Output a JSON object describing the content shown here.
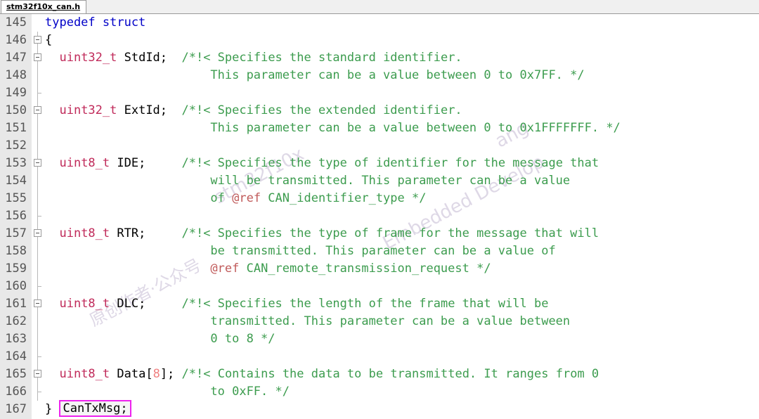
{
  "window": {
    "tab_label": "stm32f10x_can.h"
  },
  "watermark": {
    "line1": "stm32f10x",
    "line2": "Embedded Develop",
    "line3": "ang",
    "line4": "原创作者·公众号"
  },
  "editor": {
    "first_line_number": 145,
    "highlight_color": "#ee22ee",
    "keyword_color": "#0000c8",
    "type_color": "#c02a5a",
    "comment_color": "#3c9c4e",
    "doctag_color": "#c05a5a",
    "number_color": "#f08080",
    "gutter_color": "#e8e8e8",
    "lines": [
      {
        "n": "145",
        "fold": "none",
        "tokens": [
          {
            "t": "kw",
            "s": "typedef struct"
          }
        ]
      },
      {
        "n": "146",
        "fold": "box",
        "tokens": [
          {
            "t": "plain",
            "s": "{"
          }
        ]
      },
      {
        "n": "147",
        "fold": "box",
        "tokens": [
          {
            "t": "plain",
            "s": "  "
          },
          {
            "t": "typ",
            "s": "uint32_t"
          },
          {
            "t": "plain",
            "s": " StdId;  "
          },
          {
            "t": "cmt",
            "s": "/*!< Specifies the standard identifier."
          }
        ]
      },
      {
        "n": "148",
        "fold": "line",
        "tokens": [
          {
            "t": "cmt",
            "s": "                       This parameter can be a value between 0 to 0x7FF. */"
          }
        ]
      },
      {
        "n": "149",
        "fold": "tick",
        "tokens": [
          {
            "t": "plain",
            "s": ""
          }
        ]
      },
      {
        "n": "150",
        "fold": "box",
        "tokens": [
          {
            "t": "plain",
            "s": "  "
          },
          {
            "t": "typ",
            "s": "uint32_t"
          },
          {
            "t": "plain",
            "s": " ExtId;  "
          },
          {
            "t": "cmt",
            "s": "/*!< Specifies the extended identifier."
          }
        ]
      },
      {
        "n": "151",
        "fold": "line",
        "tokens": [
          {
            "t": "cmt",
            "s": "                       This parameter can be a value between 0 to 0x1FFFFFFF. */"
          }
        ]
      },
      {
        "n": "152",
        "fold": "line",
        "tokens": [
          {
            "t": "plain",
            "s": ""
          }
        ]
      },
      {
        "n": "153",
        "fold": "box",
        "tokens": [
          {
            "t": "plain",
            "s": "  "
          },
          {
            "t": "typ",
            "s": "uint8_t"
          },
          {
            "t": "plain",
            "s": " IDE;     "
          },
          {
            "t": "cmt",
            "s": "/*!< Specifies the type of identifier for the message that"
          }
        ]
      },
      {
        "n": "154",
        "fold": "line",
        "tokens": [
          {
            "t": "cmt",
            "s": "                       will be transmitted. This parameter can be a value"
          }
        ]
      },
      {
        "n": "155",
        "fold": "line",
        "tokens": [
          {
            "t": "cmt",
            "s": "                       of "
          },
          {
            "t": "tag",
            "s": "@ref"
          },
          {
            "t": "cmt",
            "s": " CAN_identifier_type */"
          }
        ]
      },
      {
        "n": "156",
        "fold": "tick",
        "tokens": [
          {
            "t": "plain",
            "s": ""
          }
        ]
      },
      {
        "n": "157",
        "fold": "box",
        "tokens": [
          {
            "t": "plain",
            "s": "  "
          },
          {
            "t": "typ",
            "s": "uint8_t"
          },
          {
            "t": "plain",
            "s": " RTR;     "
          },
          {
            "t": "cmt",
            "s": "/*!< Specifies the type of frame for the message that will"
          }
        ]
      },
      {
        "n": "158",
        "fold": "line",
        "tokens": [
          {
            "t": "cmt",
            "s": "                       be transmitted. This parameter can be a value of"
          }
        ]
      },
      {
        "n": "159",
        "fold": "line",
        "tokens": [
          {
            "t": "cmt",
            "s": "                       "
          },
          {
            "t": "tag",
            "s": "@ref"
          },
          {
            "t": "cmt",
            "s": " CAN_remote_transmission_request */"
          }
        ]
      },
      {
        "n": "160",
        "fold": "tick",
        "tokens": [
          {
            "t": "plain",
            "s": ""
          }
        ]
      },
      {
        "n": "161",
        "fold": "box",
        "tokens": [
          {
            "t": "plain",
            "s": "  "
          },
          {
            "t": "typ",
            "s": "uint8_t"
          },
          {
            "t": "plain",
            "s": " DLC;     "
          },
          {
            "t": "cmt",
            "s": "/*!< Specifies the length of the frame that will be"
          }
        ]
      },
      {
        "n": "162",
        "fold": "line",
        "tokens": [
          {
            "t": "cmt",
            "s": "                       transmitted. This parameter can be a value between"
          }
        ]
      },
      {
        "n": "163",
        "fold": "line",
        "tokens": [
          {
            "t": "cmt",
            "s": "                       0 to 8 */"
          }
        ]
      },
      {
        "n": "164",
        "fold": "tick",
        "tokens": [
          {
            "t": "plain",
            "s": ""
          }
        ]
      },
      {
        "n": "165",
        "fold": "box",
        "tokens": [
          {
            "t": "plain",
            "s": "  "
          },
          {
            "t": "typ",
            "s": "uint8_t"
          },
          {
            "t": "plain",
            "s": " Data["
          },
          {
            "t": "num",
            "s": "8"
          },
          {
            "t": "plain",
            "s": "]; "
          },
          {
            "t": "cmt",
            "s": "/*!< Contains the data to be transmitted. It ranges from 0"
          }
        ]
      },
      {
        "n": "166",
        "fold": "tick",
        "tokens": [
          {
            "t": "cmt",
            "s": "                       to 0xFF. */"
          }
        ]
      },
      {
        "n": "167",
        "fold": "none",
        "tokens": [
          {
            "t": "plain",
            "s": "} "
          },
          {
            "t": "boxed",
            "s": "CanTxMsg;"
          }
        ]
      }
    ]
  }
}
